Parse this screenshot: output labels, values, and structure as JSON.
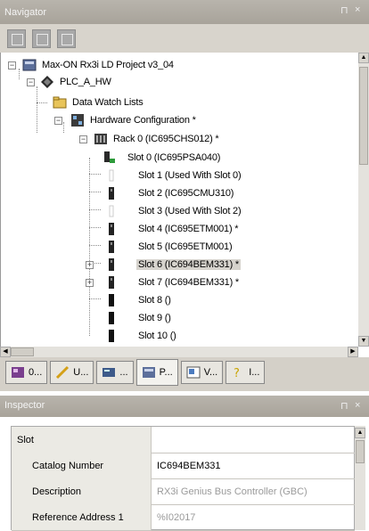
{
  "navigator": {
    "title": "Navigator",
    "pin": "⊓",
    "close": "×"
  },
  "toolbar": {
    "buttons": [
      "expand-all-icon",
      "collapse-all-icon",
      "properties-icon"
    ]
  },
  "tree": {
    "project": "Max-ON Rx3i LD Project v3_04",
    "plc": "PLC_A_HW",
    "data_watch": "Data Watch Lists",
    "hw_config": "Hardware Configuration *",
    "rack": "Rack 0 (IC695CHS012) *",
    "slots": [
      "Slot 0 (IC695PSA040)",
      "Slot 1 (Used With Slot 0)",
      "Slot 2 (IC695CMU310)",
      "Slot 3 (Used With Slot 2)",
      "Slot 4 (IC695ETM001) *",
      "Slot 5 (IC695ETM001)",
      "Slot 6 (IC694BEM331) *",
      "Slot 7 (IC694BEM331) *",
      "Slot 8 ()",
      "Slot 9 ()",
      "Slot 10 ()"
    ],
    "selected_slot": "Slot 6 (IC694BEM331) *"
  },
  "tabs": [
    {
      "label": "0...",
      "icon": "project-icon"
    },
    {
      "label": "U...",
      "icon": "utilities-icon"
    },
    {
      "label": "...",
      "icon": "options-icon"
    },
    {
      "label": "P...",
      "icon": "project-tree-icon"
    },
    {
      "label": "V...",
      "icon": "variables-icon"
    },
    {
      "label": "I...",
      "icon": "info-icon"
    }
  ],
  "inspector": {
    "title": "Inspector",
    "pin": "⊓",
    "close": "×",
    "rows": [
      {
        "name": "Slot",
        "value": ""
      },
      {
        "name": "Catalog Number",
        "value": "IC694BEM331"
      },
      {
        "name": "Description",
        "value": "RX3i Genius Bus Controller (GBC)"
      },
      {
        "name": "Reference Address 1",
        "value": "%I02017"
      }
    ]
  },
  "colors": {
    "titlebar": "#aca79f",
    "panel": "#d4d0c8",
    "selection": "#d6d3cd"
  }
}
